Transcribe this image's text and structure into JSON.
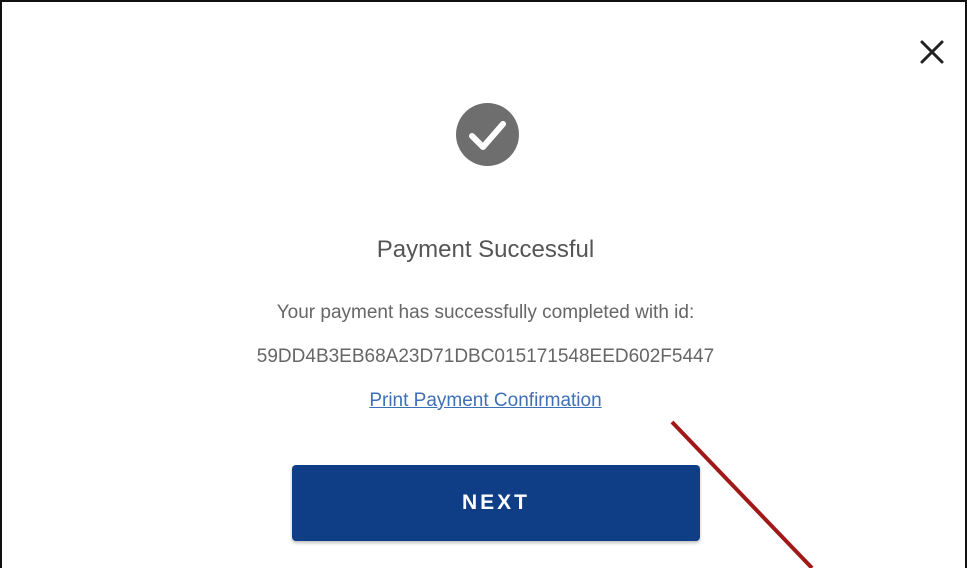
{
  "dialog": {
    "close_symbol": "✕",
    "title": "Payment Successful",
    "message": "Your payment has successfully completed with id:",
    "transaction_id": "59DD4B3EB68A23D71DBC015171548EED602F5447",
    "print_link_label": "Print Payment Confirmation",
    "next_button_label": "NEXT"
  },
  "icons": {
    "close": "close-icon",
    "success": "checkmark-circle-icon"
  },
  "colors": {
    "primary_button": "#103e86",
    "link": "#3e70b8",
    "icon_gray": "#6e6e6e",
    "annotation_arrow": "#a01818"
  }
}
